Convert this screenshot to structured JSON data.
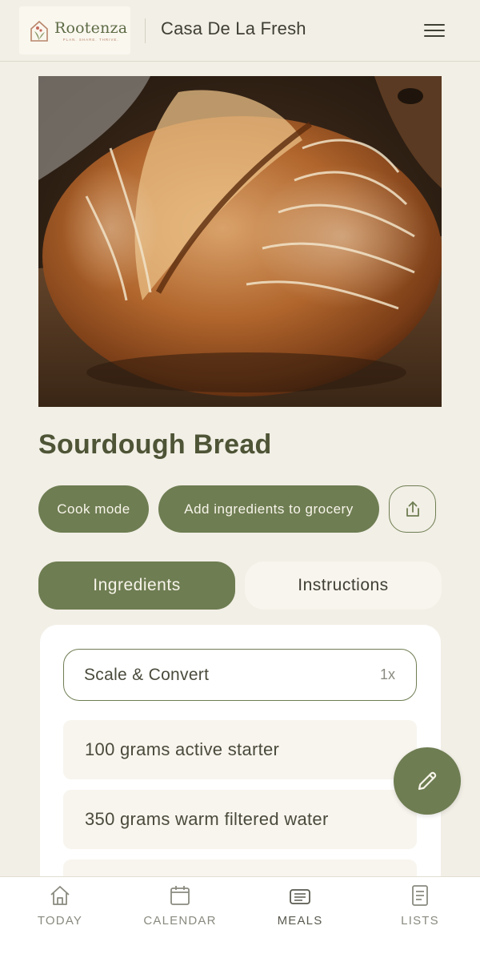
{
  "header": {
    "logo_name": "Rootenza",
    "logo_tagline": "PLAN. SHARE. THRIVE.",
    "household_name": "Casa De La Fresh",
    "menu_icon": "hamburger-menu-icon"
  },
  "recipe": {
    "title": "Sourdough Bread",
    "image_subject": "sourdough-loaf"
  },
  "actions": {
    "cook_mode": "Cook mode",
    "add_to_grocery": "Add ingredients to grocery",
    "share_icon": "share-icon"
  },
  "tabs": [
    {
      "label": "Ingredients",
      "active": true
    },
    {
      "label": "Instructions",
      "active": false
    }
  ],
  "scale": {
    "label": "Scale & Convert",
    "value": "1x"
  },
  "ingredients": [
    {
      "text": "100 grams active starter"
    },
    {
      "text": "350 grams warm filtered water"
    },
    {
      "text": ""
    }
  ],
  "fab": {
    "icon": "pencil-edit-icon"
  },
  "bottom_nav": [
    {
      "label": "TODAY",
      "icon": "home-icon",
      "active": false
    },
    {
      "label": "CALENDAR",
      "icon": "calendar-icon",
      "active": false
    },
    {
      "label": "MEALS",
      "icon": "meals-tray-icon",
      "active": true
    },
    {
      "label": "LISTS",
      "icon": "list-document-icon",
      "active": false
    }
  ],
  "colors": {
    "background": "#f2efe6",
    "accent": "#6e7d52",
    "card": "#ffffff",
    "item_bg": "#f8f5ee"
  }
}
